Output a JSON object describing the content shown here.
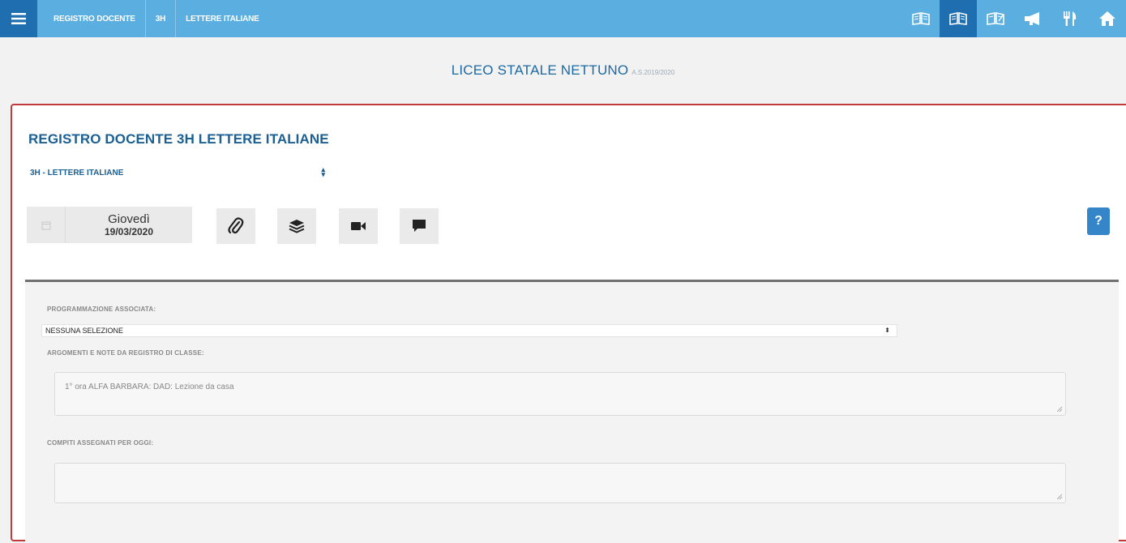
{
  "topbar": {
    "breadcrumbs": [
      "REGISTRO DOCENTE",
      "3H",
      "LETTERE ITALIANE"
    ],
    "icons": [
      "book-icon",
      "book-icon",
      "book-icon",
      "megaphone-icon",
      "cutlery-icon",
      "home-icon"
    ],
    "colors": {
      "bar": "#5aaee0",
      "active": "#1f6fb0"
    }
  },
  "school": {
    "name": "LICEO STATALE NETTUNO",
    "year": "A.S.2019/2020"
  },
  "main": {
    "title": "REGISTRO DOCENTE  3H  LETTERE ITALIANE",
    "class_select": "3H - LETTERE ITALIANE",
    "date": {
      "day": "Giovedì",
      "date": "19/03/2020"
    },
    "tools": [
      "paperclip-icon",
      "layers-icon",
      "video-icon",
      "comment-icon"
    ],
    "help_label": "?",
    "programmazione_label": "PROGRAMMAZIONE ASSOCIATA:",
    "programmazione_value": "NESSUNA SELEZIONE",
    "argomenti_label": "ARGOMENTI E NOTE DA REGISTRO DI CLASSE:",
    "argomenti_value": "1° ora ALFA BARBARA: DAD: Lezione da casa",
    "compiti_label": "COMPITI ASSEGNATI PER OGGI:",
    "compiti_value": ""
  }
}
